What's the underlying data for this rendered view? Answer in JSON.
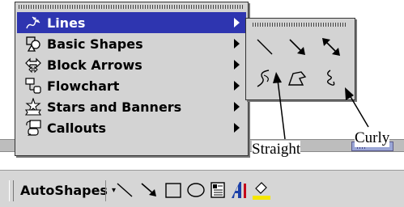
{
  "menu": {
    "items": [
      {
        "label": "Lines",
        "icon": "lines-icon",
        "selected": true
      },
      {
        "label": "Basic Shapes",
        "icon": "basic-shapes-icon",
        "selected": false
      },
      {
        "label": "Block Arrows",
        "icon": "block-arrows-icon",
        "selected": false
      },
      {
        "label": "Flowchart",
        "icon": "flowchart-icon",
        "selected": false
      },
      {
        "label": "Stars and Banners",
        "icon": "stars-banners-icon",
        "selected": false
      },
      {
        "label": "Callouts",
        "icon": "callouts-icon",
        "selected": false
      }
    ]
  },
  "submenu": {
    "tools": [
      "line-icon",
      "arrow-icon",
      "double-arrow-icon",
      "curve-icon",
      "freeform-icon",
      "scribble-icon"
    ]
  },
  "toolbar": {
    "autoshapes_label": "AutoShapes",
    "tools": [
      "line-tool-icon",
      "arrow-tool-icon",
      "rectangle-tool-icon",
      "oval-tool-icon",
      "textbox-tool-icon",
      "wordart-tool-icon",
      "fill-color-tool-icon"
    ]
  },
  "annotations": {
    "straight": "Straight",
    "curly": "Curly"
  },
  "colors": {
    "selection": "#2e35b0",
    "menu_bg": "#d3d3d3",
    "toolbar_bg": "#d6d6d6",
    "wordart_blue": "#1a3fa8",
    "fill_yellow": "#f5e600"
  }
}
